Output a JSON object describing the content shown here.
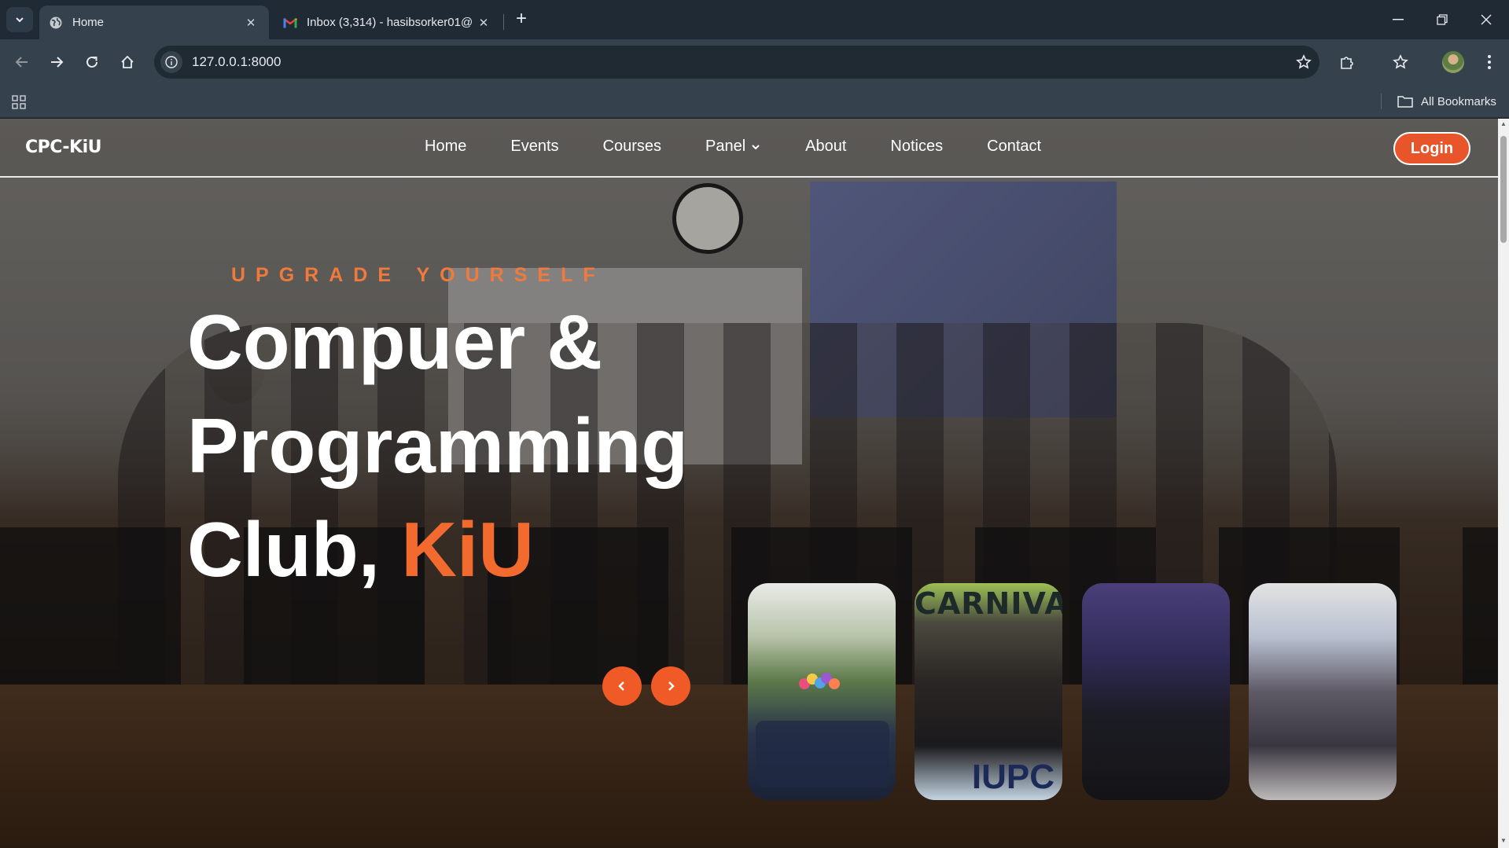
{
  "browser": {
    "tabs": [
      {
        "title": "Home",
        "favicon": "globe-icon",
        "active": true
      },
      {
        "title": "Inbox (3,314) - hasibsorker01@",
        "favicon": "gmail-icon",
        "active": false
      }
    ],
    "url": "127.0.0.1:8000",
    "bookmarks_label": "All Bookmarks"
  },
  "site": {
    "logo": "CPC-KiU",
    "nav": {
      "home": "Home",
      "events": "Events",
      "courses": "Courses",
      "panel": "Panel",
      "about": "About",
      "notices": "Notices",
      "contact": "Contact"
    },
    "login_label": "Login",
    "hero": {
      "tagline": "UPGRADE YOURSELF",
      "line1": "Compuer &",
      "line2": "Programming",
      "line3_prefix": "Club, ",
      "line3_accent": "KiU"
    },
    "slider": {
      "prev": "‹",
      "next": "›"
    },
    "thumbnails": {
      "t2_top": "CARNIVAL",
      "t2_bottom": "IUPC"
    }
  },
  "colors": {
    "accent": "#f26a2e",
    "login_bg": "#e8552b",
    "browser_frame": "#1f2a35",
    "toolbar": "#35414d"
  }
}
